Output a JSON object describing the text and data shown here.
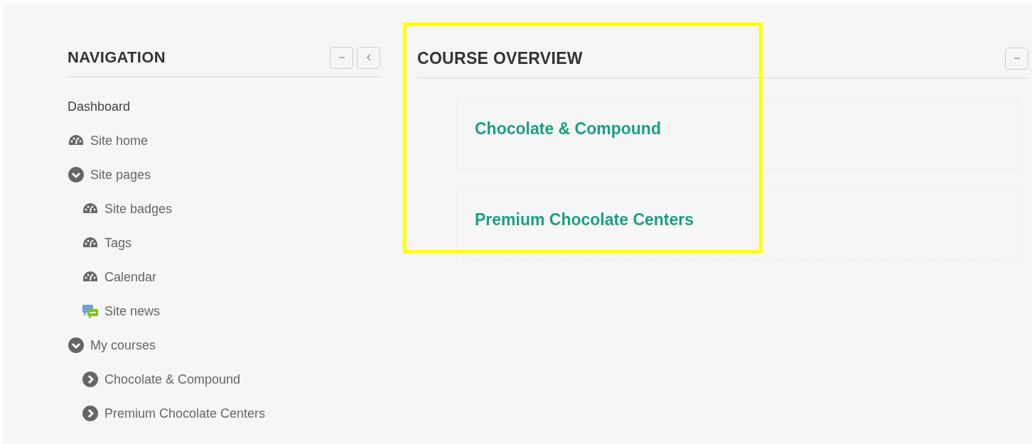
{
  "navigation": {
    "title": "NAVIGATION",
    "items": [
      {
        "label": "Dashboard",
        "kind": "plain"
      },
      {
        "label": "Site home",
        "kind": "page"
      },
      {
        "label": "Site pages",
        "kind": "branch",
        "expanded": true,
        "children": [
          {
            "label": "Site badges",
            "kind": "page"
          },
          {
            "label": "Tags",
            "kind": "page"
          },
          {
            "label": "Calendar",
            "kind": "page"
          },
          {
            "label": "Site news",
            "kind": "news"
          }
        ]
      },
      {
        "label": "My courses",
        "kind": "branch",
        "expanded": true,
        "children": [
          {
            "label": "Chocolate & Compound",
            "kind": "branch",
            "expanded": false
          },
          {
            "label": "Premium Chocolate Centers",
            "kind": "branch",
            "expanded": false
          }
        ]
      }
    ]
  },
  "course_overview": {
    "title": "COURSE OVERVIEW",
    "highlighted": true,
    "courses": [
      "Chocolate & Compound",
      "Premium Chocolate Centers"
    ]
  }
}
